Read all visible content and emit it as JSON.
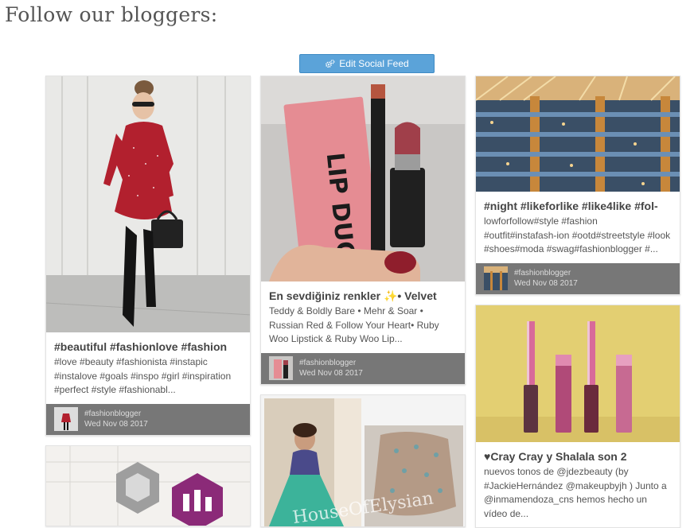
{
  "page": {
    "title": "Follow our bloggers:"
  },
  "toolbar": {
    "edit_label": "Edit Social Feed"
  },
  "cards": [
    {
      "title": "#beautiful #fashionlove #fashion",
      "text": "#love #beauty #fashionista #instapic #instalove #goals #inspo #girl #inspiration #perfect #style #fashionabl...",
      "author": "#fashionblogger",
      "date": "Wed Nov 08 2017"
    },
    {
      "title": "En sevdiğiniz renkler ✨• Velvet",
      "text": "Teddy & Boldly Bare • Mehr & Soar • Russian Red & Follow Your Heart• Ruby Woo Lipstick & Ruby Woo Lip...",
      "author": "#fashionblogger",
      "date": "Wed Nov 08 2017",
      "image_text": "LIP DUO"
    },
    {
      "title": "#night #likeforlike #like4like #fol-",
      "text": "lowforfollow#style #fashion #outfit#instafash-ion #ootd#streetstyle #look #shoes#moda #swag#fashionblogger #...",
      "author": "#fashionblogger",
      "date": "Wed Nov 08 2017"
    },
    {
      "title": "♥Cray Cray y Shalala son 2",
      "text": "nuevos tonos de @jdezbeauty (by #JackieHernández @makeupbyjh ) Junto a @inmamendoza_cns hemos hecho un vídeo de..."
    },
    {
      "image_text": "HouseOfElysian"
    },
    {}
  ],
  "colors": {
    "button": "#5ba3d9",
    "footer": "#777777"
  }
}
